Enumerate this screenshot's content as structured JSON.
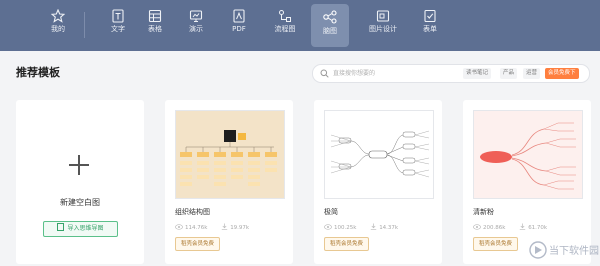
{
  "nav": {
    "items": [
      {
        "label": "我的",
        "icon": "star-icon"
      },
      {
        "label": "文字",
        "icon": "document-icon"
      },
      {
        "label": "表格",
        "icon": "table-icon"
      },
      {
        "label": "演示",
        "icon": "presentation-icon"
      },
      {
        "label": "PDF",
        "icon": "pdf-icon"
      },
      {
        "label": "流程图",
        "icon": "flowchart-icon"
      },
      {
        "label": "脑图",
        "icon": "mindmap-icon"
      },
      {
        "label": "图片设计",
        "icon": "image-design-icon"
      },
      {
        "label": "表单",
        "icon": "form-icon"
      }
    ],
    "active": "脑图"
  },
  "main": {
    "section_title": "推荐模板",
    "search": {
      "placeholder": "直接搜你想要的",
      "tags": [
        "读书笔记",
        "产品",
        "运营"
      ],
      "vip_tag": "会员免费下"
    },
    "new_card": {
      "title": "新建空白图",
      "import_label": "导入思维导图"
    },
    "templates": [
      {
        "name": "组织结构图",
        "views": "114.76k",
        "downloads": "19.97k",
        "badge": "稻壳会员免费"
      },
      {
        "name": "极简",
        "views": "100.25k",
        "downloads": "14.37k",
        "badge": "稻壳会员免费"
      },
      {
        "name": "清新粉",
        "views": "200.86k",
        "downloads": "61.70k",
        "badge": "稻壳会员免费"
      }
    ]
  },
  "watermark": {
    "text": "当下软件园"
  },
  "colors": {
    "topbar": "#5d6f92",
    "active_nav": "#7e8fae",
    "vip": "#ff7f3f",
    "import": "#36a36a"
  }
}
